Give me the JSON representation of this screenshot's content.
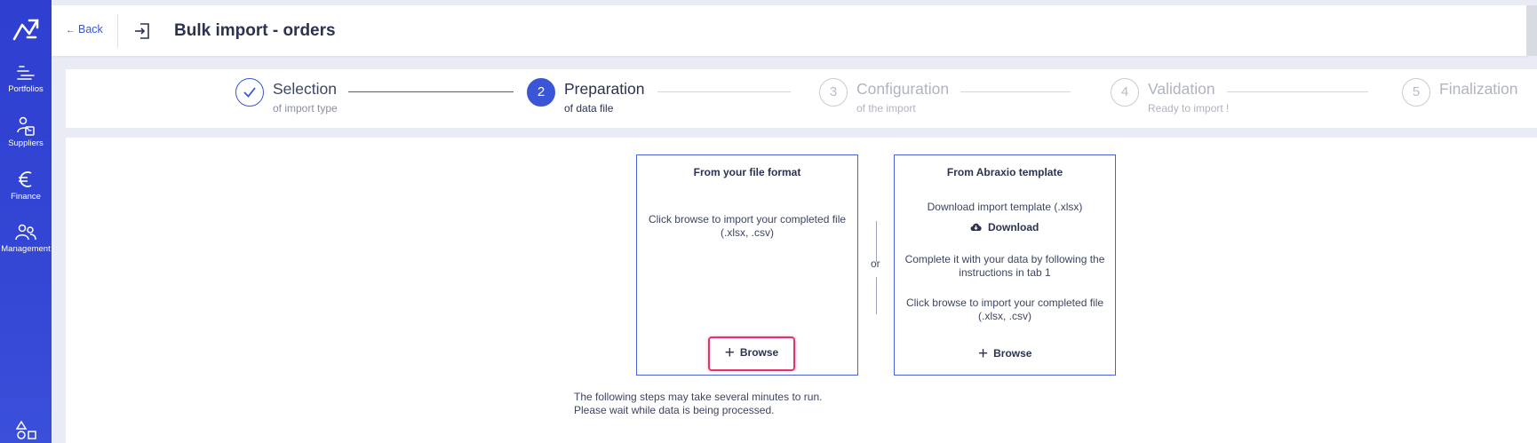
{
  "sidebar": {
    "logo": "abraxio-logo-icon",
    "items": [
      {
        "label": "Portfolios",
        "icon": "portfolios-icon"
      },
      {
        "label": "Suppliers",
        "icon": "suppliers-icon"
      },
      {
        "label": "Finance",
        "icon": "euro-icon"
      },
      {
        "label": "Management",
        "icon": "management-icon"
      }
    ],
    "bottom_icon": "shapes-icon"
  },
  "header": {
    "back_label": "Back",
    "title": "Bulk import - orders"
  },
  "stepper": {
    "steps": [
      {
        "number": "",
        "title": "Selection",
        "subtitle": "of import type",
        "state": "done"
      },
      {
        "number": "2",
        "title": "Preparation",
        "subtitle": "of data file",
        "state": "active"
      },
      {
        "number": "3",
        "title": "Configuration",
        "subtitle": "of the import",
        "state": "pending"
      },
      {
        "number": "4",
        "title": "Validation",
        "subtitle": "Ready to import !",
        "state": "pending"
      },
      {
        "number": "5",
        "title": "Finalization",
        "subtitle": "",
        "state": "pending"
      }
    ]
  },
  "file_format_card": {
    "title": "From your file format",
    "instruction": "Click browse to import your completed file (.xlsx, .csv)",
    "browse_label": "Browse"
  },
  "separator": {
    "label": "or"
  },
  "template_card": {
    "title": "From Abraxio template",
    "download_text": "Download import template (.xlsx)",
    "download_label": "Download",
    "complete_text": "Complete it with your data by following the instructions in tab 1",
    "browse_text": "Click browse to import your completed file (.xlsx, .csv)",
    "browse_label": "Browse"
  },
  "note": {
    "line1": "The following steps may take several minutes to run.",
    "line2": "Please wait while data is being processed."
  },
  "colors": {
    "accent": "#3a55d6",
    "sidebar": "#3346d4",
    "highlight": "#e2336b"
  }
}
